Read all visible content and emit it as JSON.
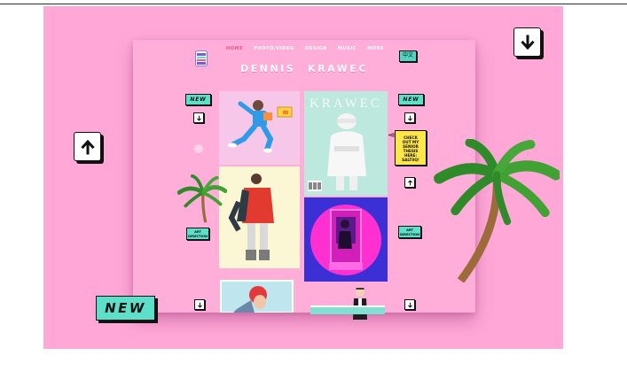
{
  "nav": {
    "items": [
      {
        "label": "HOME",
        "active": true
      },
      {
        "label": "PHOTO/VIDEO",
        "active": false
      },
      {
        "label": "DESIGN",
        "active": false
      },
      {
        "label": "MUSIC",
        "active": false
      },
      {
        "label": "MORE",
        "active": false
      }
    ],
    "language_button": "中文"
  },
  "site": {
    "title_first": "DENNIS",
    "title_last": "KRAWEC"
  },
  "badges": {
    "new_left": "NEW",
    "new_right": "NEW",
    "new_big": "NEW",
    "art_direction_left": [
      "ART",
      "DIRECTION"
    ],
    "art_direction_right": [
      "ART",
      "DIRECTION"
    ]
  },
  "thesis_sticker": {
    "lines": [
      "CHECK",
      "OUT MY",
      "SENIOR",
      "THESIS",
      "HERE:",
      "SALTIIQ!"
    ]
  },
  "tiles": {
    "krawec_label": "KRAWEC"
  },
  "colors": {
    "page_pink": "#ffa8d8",
    "site_pink": "#ffadd9",
    "teal_accent": "#5de0c9",
    "sticker_yellow": "#ffe74a",
    "nav_active": "#f3588f"
  },
  "icons": {
    "arrow_down": "arrow-down-icon",
    "arrow_up": "arrow-up-icon",
    "palm_tree": "palm-tree-icon"
  }
}
